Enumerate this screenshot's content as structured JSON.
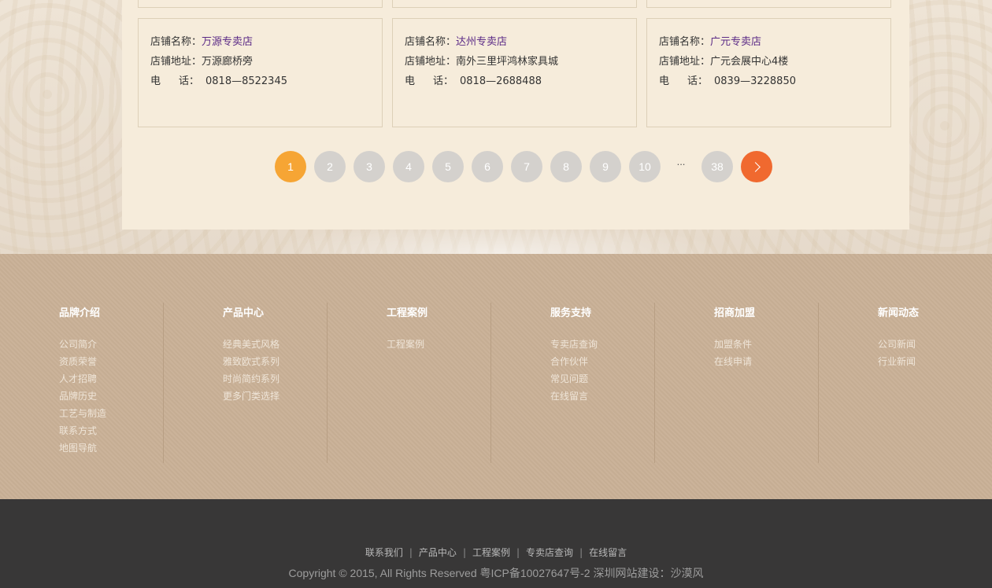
{
  "stores": {
    "label_name": "店铺名称：",
    "label_address": "店铺地址：",
    "label_phone_a": "电",
    "label_phone_b": "话：",
    "items": [
      {
        "name": "万源专卖店",
        "address": "万源廊桥旁",
        "phone": "0818—8522345"
      },
      {
        "name": "达州专卖店",
        "address": "南外三里坪鸿林家具城",
        "phone": "0818—2688488"
      },
      {
        "name": "广元专卖店",
        "address": "广元会展中心4楼",
        "phone": "0839—3228850"
      }
    ]
  },
  "pagination": {
    "pages": [
      "1",
      "2",
      "3",
      "4",
      "5",
      "6",
      "7",
      "8",
      "9",
      "10"
    ],
    "ellipsis": "...",
    "last": "38",
    "current": "1",
    "colors": {
      "active": "#f6a534",
      "inactive": "#d4d1cd",
      "next": "#f0692f"
    }
  },
  "footer": {
    "columns": [
      {
        "title": "品牌介绍",
        "links": [
          "公司简介",
          "资质荣誉",
          "人才招聘",
          "品牌历史",
          "工艺与制造",
          "联系方式",
          "地图导航"
        ]
      },
      {
        "title": "产品中心",
        "links": [
          "经典美式风格",
          "雅致欧式系列",
          "时尚简约系列",
          "更多门类选择"
        ]
      },
      {
        "title": "工程案例",
        "links": [
          "工程案例"
        ]
      },
      {
        "title": "服务支持",
        "links": [
          "专卖店查询",
          "合作伙伴",
          "常见问题",
          "在线留言"
        ]
      },
      {
        "title": "招商加盟",
        "links": [
          "加盟条件",
          "在线申请"
        ]
      },
      {
        "title": "新闻动态",
        "links": [
          "公司新闻",
          "行业新闻"
        ]
      }
    ],
    "bottom_links": [
      "联系我们",
      "产品中心",
      "工程案例",
      "专卖店查询",
      "在线留言"
    ],
    "separator": "|",
    "copyright": "Copyright © 2015, All Rights Reserved 粤ICP备10027647号-2 深圳网站建设：沙漠风"
  }
}
